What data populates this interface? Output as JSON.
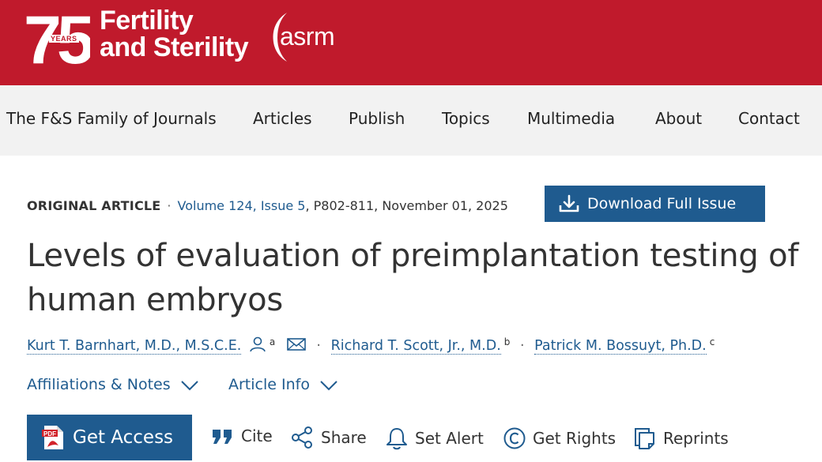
{
  "header": {
    "anniversary_number": "75",
    "anniversary_label": "YEARS",
    "journal_line1": "Fertility",
    "journal_line2": "and Sterility",
    "partner_logo_text": "asrm",
    "colors": {
      "brand_red": "#c01a2c",
      "link_blue": "#1f5b8f",
      "nav_bg": "#f2f2f2"
    }
  },
  "nav": {
    "items": [
      {
        "label": "The F&S Family of Journals"
      },
      {
        "label": "Articles"
      },
      {
        "label": "Publish"
      },
      {
        "label": "Topics"
      },
      {
        "label": "Multimedia"
      },
      {
        "label": "About"
      },
      {
        "label": "Contact"
      }
    ]
  },
  "article": {
    "type": "ORIGINAL ARTICLE",
    "volume_issue": "Volume 124, Issue 5",
    "pages_date": ", P802-811, November 01, 2025",
    "download_label": "Download Full Issue",
    "title": "Levels of evaluation of preimplantation testing of human embryos",
    "authors": [
      {
        "name": "Kurt T. Barnhart, M.D., M.S.C.E.",
        "sup": "a",
        "icons": [
          "person-icon",
          "mail-icon"
        ]
      },
      {
        "name": "Richard T. Scott, Jr., M.D.",
        "sup": "b"
      },
      {
        "name": "Patrick M. Bossuyt, Ph.D.",
        "sup": "c"
      }
    ],
    "affiliations_label": "Affiliations & Notes",
    "article_info_label": "Article Info"
  },
  "actions": {
    "get_access": "Get Access",
    "cite": "Cite",
    "share": "Share",
    "set_alert": "Set Alert",
    "get_rights": "Get Rights",
    "reprints": "Reprints"
  }
}
